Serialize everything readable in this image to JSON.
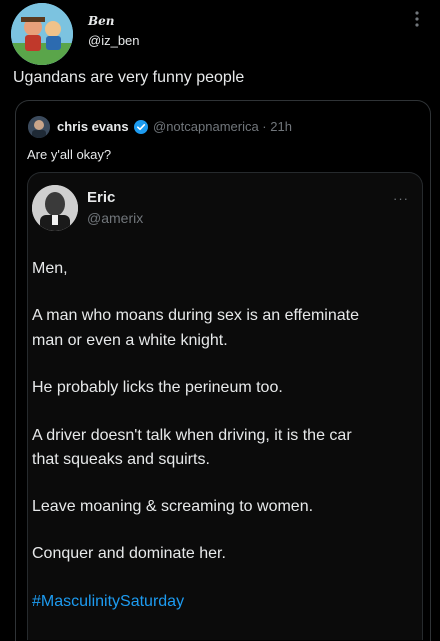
{
  "tweet": {
    "display_name": "Ben",
    "handle": "@iz_ben",
    "text": "Ugandans are very funny people"
  },
  "quote": {
    "name": "chris evans",
    "meta": "@notcapnamerica · 21h",
    "text": "Are y'all okay?"
  },
  "inner": {
    "name": "Eric",
    "handle": "@amerix",
    "more": "···",
    "lines": [
      "Men,",
      "A man who moans during sex is an effeminate",
      "man or even a white knight.",
      "He probably licks the perineum too.",
      "A driver doesn't talk when driving, it is the car",
      "that squeaks and squirts.",
      "Leave moaning & screaming to women.",
      "Conquer and dominate her."
    ],
    "hashtag": "#MasculinitySaturday"
  },
  "colors": {
    "background": "#000000",
    "text": "#e7e9ea",
    "muted": "#71767b",
    "link": "#1d9bf0",
    "verified": "#1d9bf0",
    "border": "#2f3336"
  },
  "icons": [
    "more-vertical-icon",
    "verified-badge-icon",
    "more-horizontal-icon"
  ]
}
